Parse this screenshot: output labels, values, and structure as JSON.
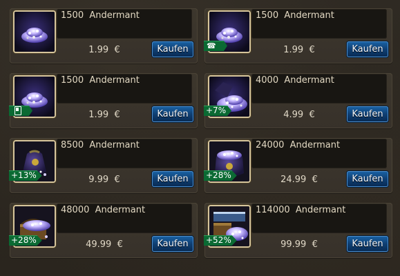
{
  "shop": {
    "offers": [
      {
        "title": "1500  Andermant",
        "price": "1.99  €",
        "button": "Kaufen",
        "badge": "",
        "badge_icon": "",
        "image": "small-gem-pile"
      },
      {
        "title": "1500  Andermant",
        "price": "1.99  €",
        "button": "Kaufen",
        "badge": "",
        "badge_icon": "telephone-icon",
        "image": "small-gem-pile"
      },
      {
        "title": "1500  Andermant",
        "price": "1.99  €",
        "button": "Kaufen",
        "badge": "",
        "badge_icon": "mobile-phone-icon",
        "image": "small-gem-pile"
      },
      {
        "title": "4000  Andermant",
        "price": "4.99  €",
        "button": "Kaufen",
        "badge": "+7%",
        "badge_icon": "",
        "image": "gem-bag"
      },
      {
        "title": "8500  Andermant",
        "price": "9.99  €",
        "button": "Kaufen",
        "badge": "+13%",
        "badge_icon": "",
        "image": "gem-sack"
      },
      {
        "title": "24000  Andermant",
        "price": "24.99  €",
        "button": "Kaufen",
        "badge": "+28%",
        "badge_icon": "",
        "image": "large-gem-sack"
      },
      {
        "title": "48000  Andermant",
        "price": "49.99  €",
        "button": "Kaufen",
        "badge": "+28%",
        "badge_icon": "",
        "image": "gem-chest"
      },
      {
        "title": "114000  Andermant",
        "price": "99.99  €",
        "button": "Kaufen",
        "badge": "+52%",
        "badge_icon": "",
        "image": "treasure-chest"
      }
    ]
  },
  "colors": {
    "background": "#2c2720",
    "card": "#3a342b",
    "title_text": "#e2d8c2",
    "button": "#0f3f73",
    "badge": "#0b6a33"
  }
}
